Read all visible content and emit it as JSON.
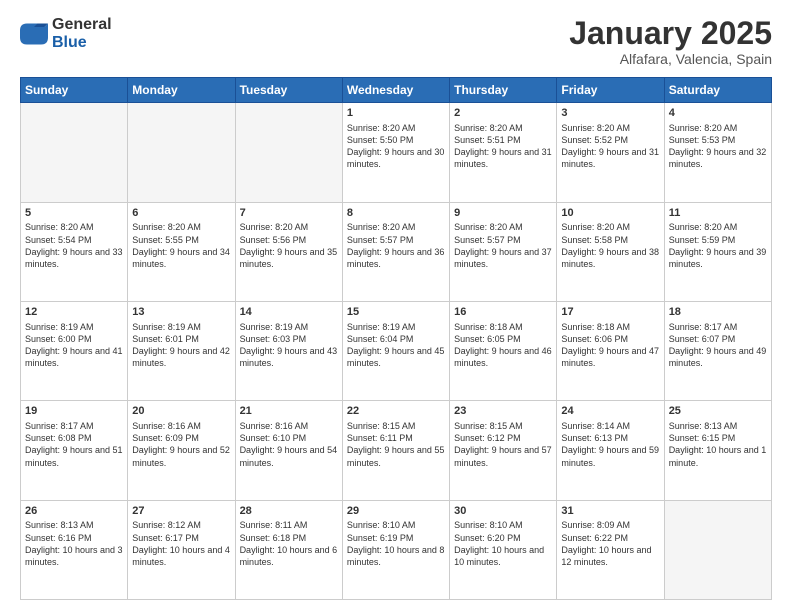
{
  "header": {
    "logo_general": "General",
    "logo_blue": "Blue",
    "month": "January 2025",
    "location": "Alfafara, Valencia, Spain"
  },
  "weekdays": [
    "Sunday",
    "Monday",
    "Tuesday",
    "Wednesday",
    "Thursday",
    "Friday",
    "Saturday"
  ],
  "weeks": [
    [
      {
        "num": "",
        "info": ""
      },
      {
        "num": "",
        "info": ""
      },
      {
        "num": "",
        "info": ""
      },
      {
        "num": "1",
        "info": "Sunrise: 8:20 AM\nSunset: 5:50 PM\nDaylight: 9 hours\nand 30 minutes."
      },
      {
        "num": "2",
        "info": "Sunrise: 8:20 AM\nSunset: 5:51 PM\nDaylight: 9 hours\nand 31 minutes."
      },
      {
        "num": "3",
        "info": "Sunrise: 8:20 AM\nSunset: 5:52 PM\nDaylight: 9 hours\nand 31 minutes."
      },
      {
        "num": "4",
        "info": "Sunrise: 8:20 AM\nSunset: 5:53 PM\nDaylight: 9 hours\nand 32 minutes."
      }
    ],
    [
      {
        "num": "5",
        "info": "Sunrise: 8:20 AM\nSunset: 5:54 PM\nDaylight: 9 hours\nand 33 minutes."
      },
      {
        "num": "6",
        "info": "Sunrise: 8:20 AM\nSunset: 5:55 PM\nDaylight: 9 hours\nand 34 minutes."
      },
      {
        "num": "7",
        "info": "Sunrise: 8:20 AM\nSunset: 5:56 PM\nDaylight: 9 hours\nand 35 minutes."
      },
      {
        "num": "8",
        "info": "Sunrise: 8:20 AM\nSunset: 5:57 PM\nDaylight: 9 hours\nand 36 minutes."
      },
      {
        "num": "9",
        "info": "Sunrise: 8:20 AM\nSunset: 5:57 PM\nDaylight: 9 hours\nand 37 minutes."
      },
      {
        "num": "10",
        "info": "Sunrise: 8:20 AM\nSunset: 5:58 PM\nDaylight: 9 hours\nand 38 minutes."
      },
      {
        "num": "11",
        "info": "Sunrise: 8:20 AM\nSunset: 5:59 PM\nDaylight: 9 hours\nand 39 minutes."
      }
    ],
    [
      {
        "num": "12",
        "info": "Sunrise: 8:19 AM\nSunset: 6:00 PM\nDaylight: 9 hours\nand 41 minutes."
      },
      {
        "num": "13",
        "info": "Sunrise: 8:19 AM\nSunset: 6:01 PM\nDaylight: 9 hours\nand 42 minutes."
      },
      {
        "num": "14",
        "info": "Sunrise: 8:19 AM\nSunset: 6:03 PM\nDaylight: 9 hours\nand 43 minutes."
      },
      {
        "num": "15",
        "info": "Sunrise: 8:19 AM\nSunset: 6:04 PM\nDaylight: 9 hours\nand 45 minutes."
      },
      {
        "num": "16",
        "info": "Sunrise: 8:18 AM\nSunset: 6:05 PM\nDaylight: 9 hours\nand 46 minutes."
      },
      {
        "num": "17",
        "info": "Sunrise: 8:18 AM\nSunset: 6:06 PM\nDaylight: 9 hours\nand 47 minutes."
      },
      {
        "num": "18",
        "info": "Sunrise: 8:17 AM\nSunset: 6:07 PM\nDaylight: 9 hours\nand 49 minutes."
      }
    ],
    [
      {
        "num": "19",
        "info": "Sunrise: 8:17 AM\nSunset: 6:08 PM\nDaylight: 9 hours\nand 51 minutes."
      },
      {
        "num": "20",
        "info": "Sunrise: 8:16 AM\nSunset: 6:09 PM\nDaylight: 9 hours\nand 52 minutes."
      },
      {
        "num": "21",
        "info": "Sunrise: 8:16 AM\nSunset: 6:10 PM\nDaylight: 9 hours\nand 54 minutes."
      },
      {
        "num": "22",
        "info": "Sunrise: 8:15 AM\nSunset: 6:11 PM\nDaylight: 9 hours\nand 55 minutes."
      },
      {
        "num": "23",
        "info": "Sunrise: 8:15 AM\nSunset: 6:12 PM\nDaylight: 9 hours\nand 57 minutes."
      },
      {
        "num": "24",
        "info": "Sunrise: 8:14 AM\nSunset: 6:13 PM\nDaylight: 9 hours\nand 59 minutes."
      },
      {
        "num": "25",
        "info": "Sunrise: 8:13 AM\nSunset: 6:15 PM\nDaylight: 10 hours\nand 1 minute."
      }
    ],
    [
      {
        "num": "26",
        "info": "Sunrise: 8:13 AM\nSunset: 6:16 PM\nDaylight: 10 hours\nand 3 minutes."
      },
      {
        "num": "27",
        "info": "Sunrise: 8:12 AM\nSunset: 6:17 PM\nDaylight: 10 hours\nand 4 minutes."
      },
      {
        "num": "28",
        "info": "Sunrise: 8:11 AM\nSunset: 6:18 PM\nDaylight: 10 hours\nand 6 minutes."
      },
      {
        "num": "29",
        "info": "Sunrise: 8:10 AM\nSunset: 6:19 PM\nDaylight: 10 hours\nand 8 minutes."
      },
      {
        "num": "30",
        "info": "Sunrise: 8:10 AM\nSunset: 6:20 PM\nDaylight: 10 hours\nand 10 minutes."
      },
      {
        "num": "31",
        "info": "Sunrise: 8:09 AM\nSunset: 6:22 PM\nDaylight: 10 hours\nand 12 minutes."
      },
      {
        "num": "",
        "info": ""
      }
    ]
  ]
}
